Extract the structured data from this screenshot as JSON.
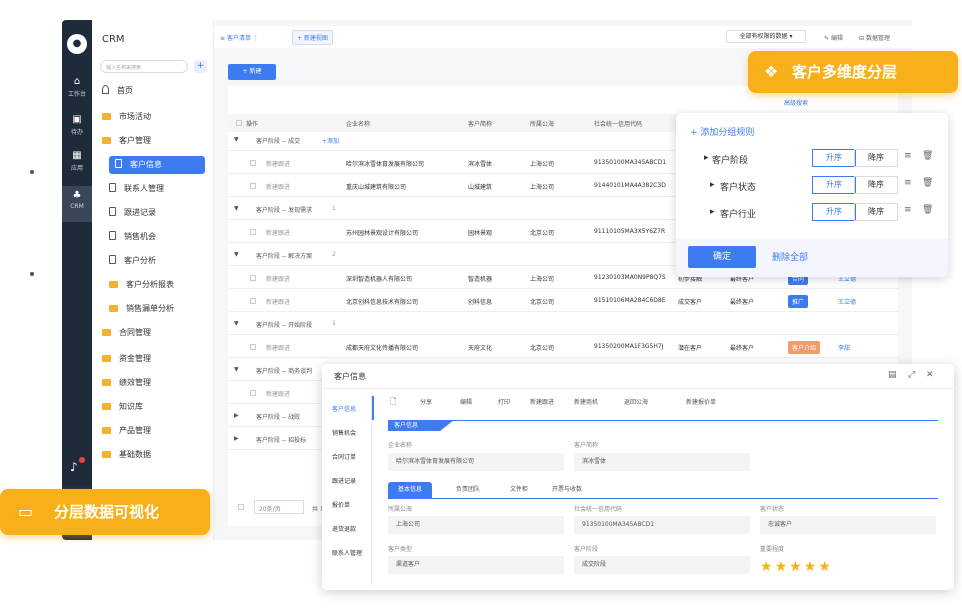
{
  "app": {
    "title": "CRM",
    "search_placeholder": "输入名称来搜索",
    "add": "+"
  },
  "rail": [
    {
      "label": "工作台",
      "icon": "home-icon"
    },
    {
      "label": "待办",
      "icon": "todo-icon"
    },
    {
      "label": "应用",
      "icon": "apps-icon"
    },
    {
      "label": "CRM",
      "icon": "crm-icon"
    }
  ],
  "sidebar": {
    "items": [
      {
        "label": "首页",
        "type": "home"
      },
      {
        "label": "市场活动",
        "type": "folder"
      },
      {
        "label": "客户管理",
        "type": "folder"
      },
      {
        "label": "客户信息",
        "type": "doc",
        "selected": true
      },
      {
        "label": "联系人管理",
        "type": "doc"
      },
      {
        "label": "跟进记录",
        "type": "doc"
      },
      {
        "label": "销售机会",
        "type": "doc"
      },
      {
        "label": "客户分析",
        "type": "clock"
      },
      {
        "label": "客户分析报表",
        "type": "folder"
      },
      {
        "label": "销售漏单分析",
        "type": "folder"
      },
      {
        "label": "合同管理",
        "type": "folder"
      },
      {
        "label": "资金管理",
        "type": "folder"
      },
      {
        "label": "绩效管理",
        "type": "folder"
      },
      {
        "label": "知识库",
        "type": "folder"
      },
      {
        "label": "产品管理",
        "type": "folder"
      },
      {
        "label": "基础数据",
        "type": "folder"
      }
    ]
  },
  "toolbar": {
    "view_tab": "客户清单",
    "new_view": "+ 新建视图",
    "scope": "全部有权限的数据",
    "edit": "编辑",
    "manage": "数据管理",
    "new_btn": "+ 新建",
    "adv_search": "高级搜索"
  },
  "table": {
    "headers": [
      "操作",
      "企业名称",
      "客户简称",
      "所属公海",
      "社会统一信用代码"
    ],
    "groups": [
      {
        "label": "客户阶段 -- 成交",
        "add": "+添加",
        "rows": [
          {
            "op": "新建跟进",
            "name": "哈尔滨冰雪体育发展有限公司",
            "short": "滨冰雪体",
            "sea": "上海公司",
            "code": "91350100MA345ABCD1"
          },
          {
            "op": "新建跟进",
            "name": "重庆山城建筑有限公司",
            "short": "山城建筑",
            "sea": "上海公司",
            "code": "91440101MA4A382C3D"
          }
        ]
      },
      {
        "label": "客户阶段 -- 发现需求",
        "count": "1",
        "rows": [
          {
            "op": "新建跟进",
            "name": "苏州园林景观设计有限公司",
            "short": "园林景观",
            "sea": "北京公司",
            "code": "91110105MA3X5Y6Z7R"
          }
        ]
      },
      {
        "label": "客户阶段 -- 解决方案",
        "count": "2",
        "rows": [
          {
            "op": "新建跟进",
            "name": "深圳智造机器人有限公司",
            "short": "智造机器",
            "sea": "上海公司",
            "code": "91230103MA0N9P8Q7S",
            "stage": "初步接触",
            "status": "最终客户",
            "tag": "合同",
            "owner": "王立德"
          },
          {
            "op": "新建跟进",
            "name": "北京创科信息技术有限公司",
            "short": "创科信息",
            "sea": "北京公司",
            "code": "91510106MA284C6D8E",
            "stage": "成交客户",
            "status": "最终客户",
            "tag": "推广",
            "owner": "王立德"
          }
        ]
      },
      {
        "label": "客户阶段 -- 开始阶段",
        "count": "1",
        "rows": [
          {
            "op": "新建跟进",
            "name": "成都天府文化传播有限公司",
            "short": "天府文化",
            "sea": "北京公司",
            "code": "91350200MA1F3G5H7J",
            "stage": "潜在客户",
            "status": "最终客户",
            "tag": "客户介绍",
            "owner": "李甜"
          }
        ]
      },
      {
        "label": "客户阶段 -- 商务谈判",
        "rows": [
          {
            "op": "新建跟进"
          }
        ]
      },
      {
        "label": "客户阶段 -- 战败"
      },
      {
        "label": "客户阶段 -- 招投标"
      }
    ],
    "pagesize": "20条/页",
    "total": "共 1"
  },
  "filter": {
    "add_rule": "+ 添加分组规则",
    "rules": [
      "客户阶段",
      "客户状态",
      "客户行业"
    ],
    "asc": "升序",
    "desc": "降序",
    "confirm": "确定",
    "clear": "删除全部"
  },
  "detail": {
    "title": "客户信息",
    "side_tabs": [
      "客户信息",
      "销售机会",
      "合同订单",
      "跟进记录",
      "报价单",
      "退货退款",
      "联系人管理"
    ],
    "actions": [
      "分享",
      "编辑",
      "打印",
      "新建跟进",
      "新建商机",
      "返回公海",
      "新建报价单"
    ],
    "section": "客户信息",
    "fields_top": [
      {
        "label": "企业名称",
        "value": "哈尔滨冰雪体育发展有限公司"
      },
      {
        "label": "客户简称",
        "value": "滨冰雪体"
      }
    ],
    "sub_tabs": [
      "基本信息",
      "负责团队",
      "文件柜",
      "开票与收数"
    ],
    "fields": [
      {
        "label": "所属公海",
        "value": "上海公司"
      },
      {
        "label": "社会统一信用代码",
        "value": "91350100MA345ABCD1"
      },
      {
        "label": "客户状态",
        "value": "忠诚客户"
      },
      {
        "label": "客户类型",
        "value": "渠道客户"
      },
      {
        "label": "客户阶段",
        "value": "成交阶段"
      },
      {
        "label": "重要程度",
        "value": "★★★★★",
        "stars": 5
      }
    ]
  },
  "banners": {
    "top": "客户多维度分层",
    "bottom": "分层数据可视化"
  },
  "colors": {
    "accent": "#3d7bf0",
    "brand": "#f8b01a",
    "rail": "#1f2a3a"
  }
}
